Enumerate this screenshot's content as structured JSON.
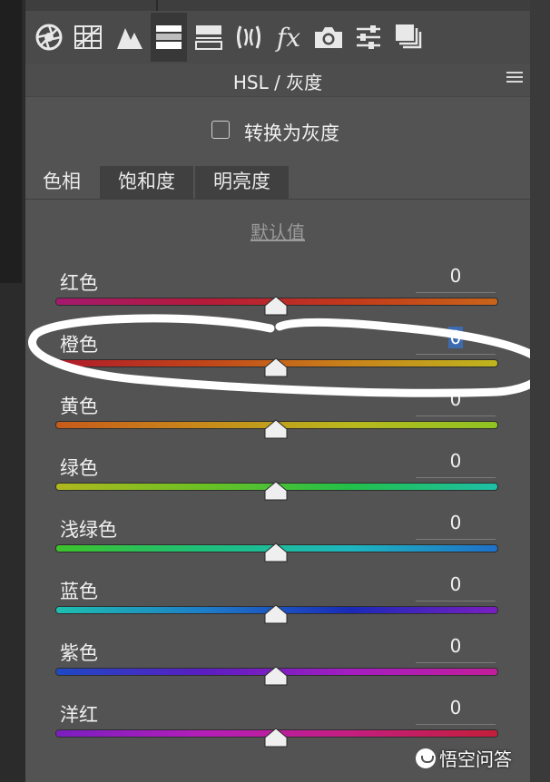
{
  "toolbar": {
    "icons": [
      "aperture-icon",
      "grid-icon",
      "mountains-icon",
      "hsl-gradient-icon",
      "split-toning-icon",
      "lens-icon",
      "fx-icon",
      "camera-icon",
      "sliders-icon",
      "stack-icon"
    ],
    "fx_label": "fx",
    "active_index": 3
  },
  "panel": {
    "title": "HSL / 灰度",
    "grayscale_checkbox_label": "转换为灰度",
    "tabs": [
      "色相",
      "饱和度",
      "明亮度"
    ],
    "active_tab": 0,
    "default_link": "默认值"
  },
  "sliders": [
    {
      "label": "红色",
      "value": "0",
      "colors": [
        "#a4196f",
        "#b51a3a",
        "#c23a1a",
        "#c9641a"
      ]
    },
    {
      "label": "橙色",
      "value": "0",
      "selected": true,
      "colors": [
        "#b01a2a",
        "#c2451a",
        "#c9831a",
        "#bfb51e"
      ]
    },
    {
      "label": "黄色",
      "value": "0",
      "colors": [
        "#c75a1a",
        "#c88a1a",
        "#b8b81e",
        "#8ec422"
      ]
    },
    {
      "label": "绿色",
      "value": "0",
      "colors": [
        "#b0b81e",
        "#6cc124",
        "#22c04a",
        "#1ebfa8"
      ]
    },
    {
      "label": "浅绿色",
      "value": "0",
      "colors": [
        "#3ec22a",
        "#1ec07a",
        "#1eb6c0",
        "#1e70c8"
      ]
    },
    {
      "label": "蓝色",
      "value": "0",
      "colors": [
        "#1ebfb0",
        "#1e7ec8",
        "#1a2ab8",
        "#7a1ec0"
      ]
    },
    {
      "label": "紫色",
      "value": "0",
      "colors": [
        "#1e48c4",
        "#5a1ec2",
        "#a41ec0",
        "#c41e9a"
      ]
    },
    {
      "label": "洋红",
      "value": "0",
      "colors": [
        "#7a1ec0",
        "#b41eb8",
        "#c41e80",
        "#c41e3a"
      ]
    }
  ],
  "colors": {
    "panel_bg": "#535353",
    "toolbar_bg": "#4a4a4a",
    "active_tool_bg": "#383838",
    "selection_blue": "#3d6bb0"
  },
  "watermark": {
    "text": "悟空问答"
  }
}
